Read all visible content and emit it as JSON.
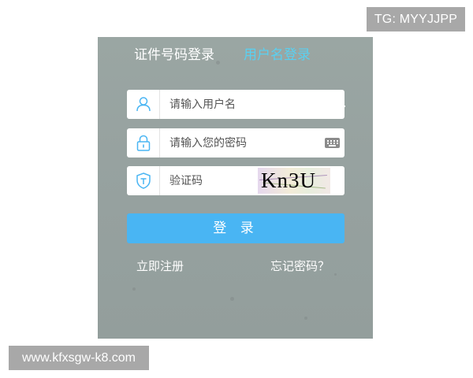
{
  "watermarks": {
    "top_right": "TG: MYYJJPP",
    "bottom_left": "www.kfxsgw-k8.com"
  },
  "login": {
    "tabs": [
      {
        "label": "证件号码登录",
        "active": false
      },
      {
        "label": "用户名登录",
        "active": true
      }
    ],
    "username": {
      "value": "",
      "placeholder": "请输入用户名",
      "icon": "user-icon"
    },
    "password": {
      "value": "",
      "placeholder": "请输入您的密码",
      "icon": "lock-icon",
      "trailing_icon": "keyboard-icon"
    },
    "captcha": {
      "value": "",
      "placeholder": "验证码",
      "icon": "shield-icon",
      "image_text": "Kn3U"
    },
    "submit_label": "登 录",
    "register_link": "立即注册",
    "forgot_link": "忘记密码？"
  },
  "colors": {
    "panel_bg": "#98a3a1",
    "active_tab": "#5ad0f0",
    "button": "#49b5f3",
    "watermark_bg": "#a8a8a8"
  }
}
